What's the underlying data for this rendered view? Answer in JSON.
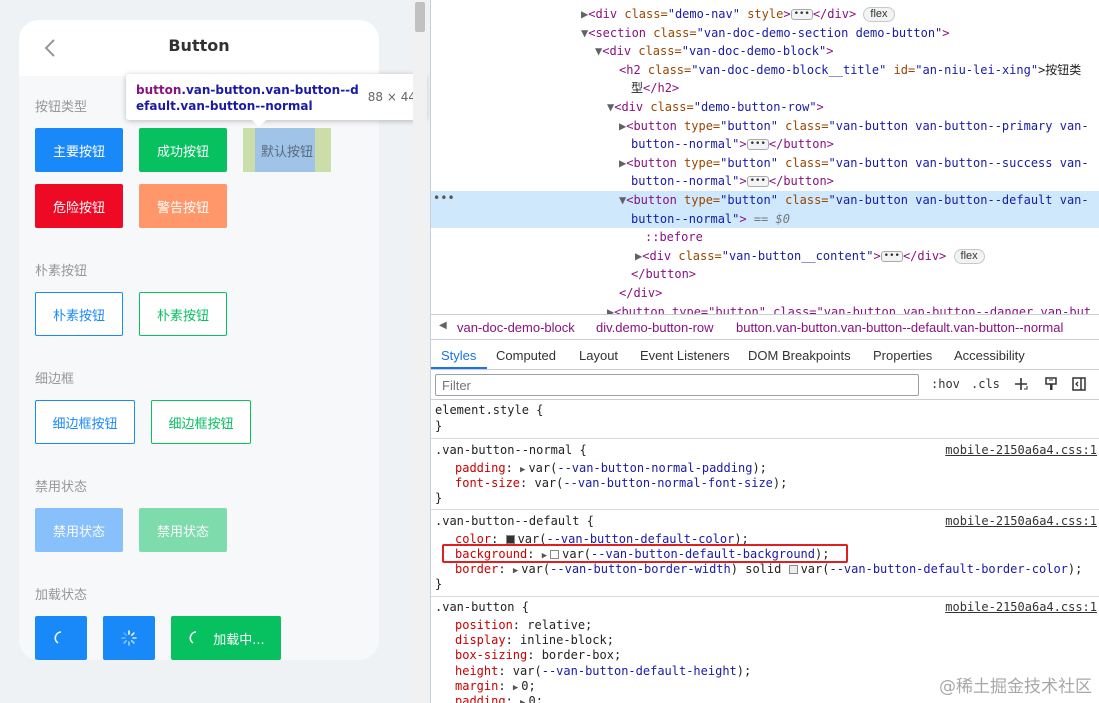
{
  "demo": {
    "nav_title": "Button",
    "sections": {
      "type": "按钮类型",
      "plain": "朴素按钮",
      "hairline": "细边框",
      "disabled": "禁用状态",
      "loading": "加载状态"
    },
    "buttons": {
      "primary": "主要按钮",
      "success": "成功按钮",
      "default": "默认按钮",
      "danger": "危险按钮",
      "warning": "警告按钮",
      "plain_primary": "朴素按钮",
      "plain_success": "朴素按钮",
      "hairline_primary": "细边框按钮",
      "hairline_success": "细边框按钮",
      "disabled_primary": "禁用状态",
      "disabled_success": "禁用状态",
      "loading_text": "加载中..."
    },
    "colors": {
      "primary": "#1989fa",
      "success": "#07c160",
      "danger": "#ee0a24",
      "warning": "#ff976a"
    }
  },
  "tooltip": {
    "selector_tag": "button",
    "selector_classes": ".van-button.van-button--default.van-button--normal",
    "size": "88 × 44"
  },
  "elements": {
    "row1_tag_open": "<div ",
    "row1_class_attr": "class=",
    "row1_class_val": "\"demo-nav\"",
    "row1_style": " style",
    "row1_close": "</div>",
    "row1_badge": "flex",
    "row2_tag": "<section ",
    "row2_attr": "class=",
    "row2_val": "\"van-doc-demo-section demo-button\"",
    "row2_end": ">",
    "row3_tag": "<div ",
    "row3_attr": "class=",
    "row3_val": "\"van-doc-demo-block\"",
    "row3_end": ">",
    "row4_tag": "<h2 ",
    "row4_attr1": "class=",
    "row4_val1": "\"van-doc-demo-block__title\"",
    "row4_attr2": " id=",
    "row4_val2": "\"an-niu-lei-xing\"",
    "row4_text": ">按钮类",
    "row5_text": "型",
    "row5_close": "</h2>",
    "row6_tag": "<div ",
    "row6_attr": "class=",
    "row6_val": "\"demo-button-row\"",
    "row6_end": ">",
    "row7_tag": "<button ",
    "row7_attr1": "type=",
    "row7_val1": "\"button\"",
    "row7_attr2": " class=",
    "row7_val2": "\"van-button van-button--primary van-",
    "row8_val": "button--normal\"",
    "row8_end": ">",
    "row8_close": "</button>",
    "row9_val2": "\"van-button van-button--success van-",
    "row10_val": "button--normal\"",
    "row11_val2": "\"van-button van-button--default van-",
    "row12_val": "button--normal\"",
    "row12_dim": " == $0",
    "row13_pseudo": "::before",
    "row14_tag": "<div ",
    "row14_attr": "class=",
    "row14_val": "\"van-button__content\"",
    "row14_end": ">",
    "row14_close": "</div>",
    "row14_badge": "flex",
    "row15_close": "</button>",
    "row16_close": "</div>",
    "row17_partial": "<button type=\"button\" class=\"van-button van-button--danger van-but"
  },
  "breadcrumbs": [
    "van-doc-demo-block",
    "div.demo-button-row",
    "button.van-button.van-button--default.van-button--normal"
  ],
  "panel_tabs": [
    "Styles",
    "Computed",
    "Layout",
    "Event Listeners",
    "DOM Breakpoints",
    "Properties",
    "Accessibility"
  ],
  "filter": {
    "placeholder": "Filter",
    "hov": ":hov",
    "cls": ".cls"
  },
  "styles": {
    "element_style": "element.style {",
    "brace_close": "}",
    "r1_sel": ".van-button--normal {",
    "r1_src": "mobile-2150a6a4.css:1",
    "r1_p1": "padding",
    "r1_v1": "--van-button-normal-padding",
    "r1_p2": "font-size",
    "r1_v2": "--van-button-normal-font-size",
    "r2_sel": ".van-button--default {",
    "r2_src": "mobile-2150a6a4.css:1",
    "r2_p1": "color",
    "r2_v1": "--van-button-default-color",
    "r2_p2": "background",
    "r2_v2": "--van-button-default-background",
    "r2_p3": "border",
    "r2_v3a": "--van-button-border-width",
    "r2_v3b": " solid ",
    "r2_v3c": "--van-button-default-border-color",
    "r3_sel": ".van-button {",
    "r3_src": "mobile-2150a6a4.css:1",
    "r3_p1": "position",
    "r3_v1": "relative",
    "r3_p2": "display",
    "r3_v2": "inline-block",
    "r3_p3": "box-sizing",
    "r3_v3": "border-box",
    "r3_p4": "height",
    "r3_v4": "--van-button-default-height",
    "r3_p5": "margin",
    "r3_v5": "0",
    "r3_p6": "padding",
    "r3_v6": "0"
  },
  "watermark": "@稀土掘金技术社区"
}
